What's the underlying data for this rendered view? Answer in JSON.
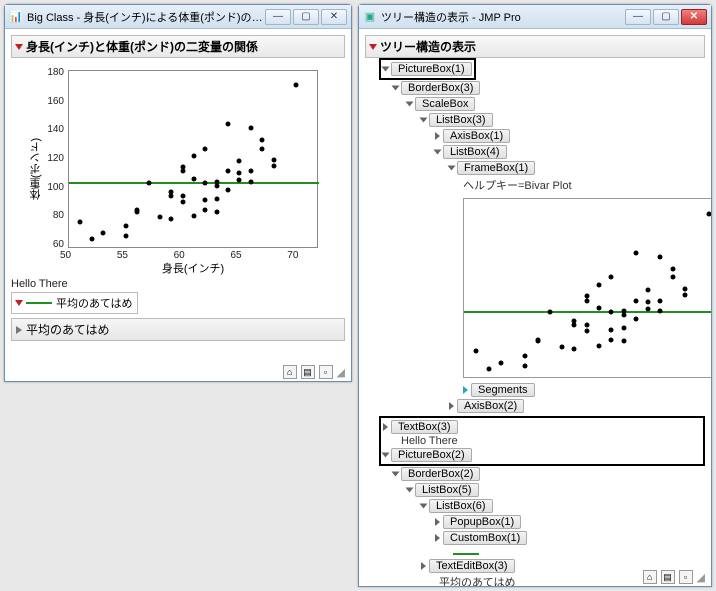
{
  "left_window": {
    "title": "Big Class - 身長(インチ)による体重(ポンド)のニ…",
    "section_title": "身長(インチ)と体重(ポンド)の二変量の関係",
    "hello_text": "Hello There",
    "legend_label": "平均のあてはめ",
    "sub_title": "平均のあてはめ"
  },
  "right_window": {
    "title": "ツリー構造の表示 - JMP Pro",
    "section_title": "ツリー構造の表示",
    "help_key": "ヘルプキー=Bivar Plot",
    "hello_text": "Hello There",
    "fit_label": "平均のあてはめ"
  },
  "tree": {
    "picturebox1": "PictureBox(1)",
    "borderbox3": "BorderBox(3)",
    "scalebox": "ScaleBox",
    "listbox3": "ListBox(3)",
    "axisbox1": "AxisBox(1)",
    "listbox4": "ListBox(4)",
    "framebox1": "FrameBox(1)",
    "segments": "Segments",
    "axisbox2": "AxisBox(2)",
    "textbox3": "TextBox(3)",
    "picturebox2": "PictureBox(2)",
    "borderbox2": "BorderBox(2)",
    "listbox5": "ListBox(5)",
    "listbox6": "ListBox(6)",
    "popupbox1": "PopupBox(1)",
    "custombox1": "CustomBox(1)",
    "texteditbox3": "TextEditBox(3)"
  },
  "chart_data": {
    "type": "scatter",
    "title": "身長(インチ)と体重(ポンド)の二変量の関係",
    "xlabel": "身長(インチ)",
    "ylabel": "体重(ポンド)",
    "xlim": [
      50,
      72
    ],
    "ylim": [
      58,
      182
    ],
    "x_ticks": [
      50,
      55,
      60,
      65,
      70
    ],
    "y_ticks": [
      60,
      80,
      100,
      120,
      140,
      160,
      180
    ],
    "mean_y": 105,
    "points": [
      [
        51,
        77
      ],
      [
        52,
        65
      ],
      [
        53,
        69
      ],
      [
        55,
        74
      ],
      [
        55,
        67
      ],
      [
        56,
        84
      ],
      [
        56,
        85
      ],
      [
        57,
        104
      ],
      [
        58,
        80
      ],
      [
        59,
        95
      ],
      [
        59,
        79
      ],
      [
        59,
        98
      ],
      [
        60,
        91
      ],
      [
        60,
        115
      ],
      [
        60,
        95
      ],
      [
        60,
        112
      ],
      [
        61,
        81
      ],
      [
        61,
        123
      ],
      [
        61,
        107
      ],
      [
        62,
        85
      ],
      [
        62,
        92
      ],
      [
        62,
        104
      ],
      [
        62,
        128
      ],
      [
        63,
        102
      ],
      [
        63,
        105
      ],
      [
        63,
        84
      ],
      [
        63,
        93
      ],
      [
        64,
        99
      ],
      [
        64,
        112
      ],
      [
        64,
        145
      ],
      [
        65,
        106
      ],
      [
        65,
        119
      ],
      [
        65,
        111
      ],
      [
        66,
        105
      ],
      [
        66,
        112
      ],
      [
        66,
        142
      ],
      [
        67,
        128
      ],
      [
        67,
        134
      ],
      [
        68,
        120
      ],
      [
        68,
        116
      ],
      [
        70,
        172
      ]
    ]
  }
}
